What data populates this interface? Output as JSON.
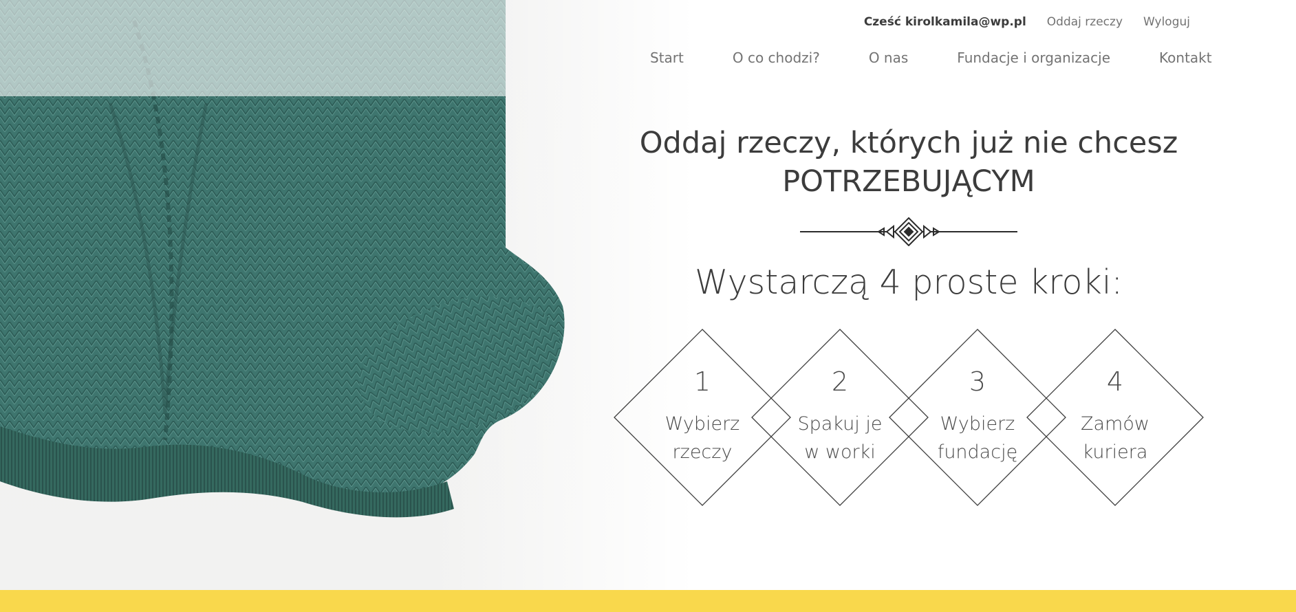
{
  "header": {
    "greeting": "Cześć kirolkamila@wp.pl",
    "give_away_link": "Oddaj rzeczy",
    "logout_link": "Wyloguj"
  },
  "nav": {
    "items": [
      {
        "label": "Start"
      },
      {
        "label": "O co chodzi?"
      },
      {
        "label": "O nas"
      },
      {
        "label": "Fundacje i organizacje"
      },
      {
        "label": "Kontakt"
      }
    ]
  },
  "hero": {
    "title_line1": "Oddaj rzeczy, których już nie chcesz",
    "title_line2": "POTRZEBUJĄCYM",
    "subtitle": "Wystarczą 4 proste kroki:",
    "steps": [
      {
        "number": "1",
        "line1": "Wybierz",
        "line2": "rzeczy"
      },
      {
        "number": "2",
        "line1": "Spakuj je",
        "line2": "w worki"
      },
      {
        "number": "3",
        "line1": "Wybierz",
        "line2": "fundację"
      },
      {
        "number": "4",
        "line1": "Zamów",
        "line2": "kuriera"
      }
    ]
  },
  "colors": {
    "sweater": "#3e756e",
    "sweater_dark": "#2d5b55",
    "accent_yellow": "#f9d84c",
    "text": "#3c3c3c",
    "nav_text": "#737373"
  }
}
